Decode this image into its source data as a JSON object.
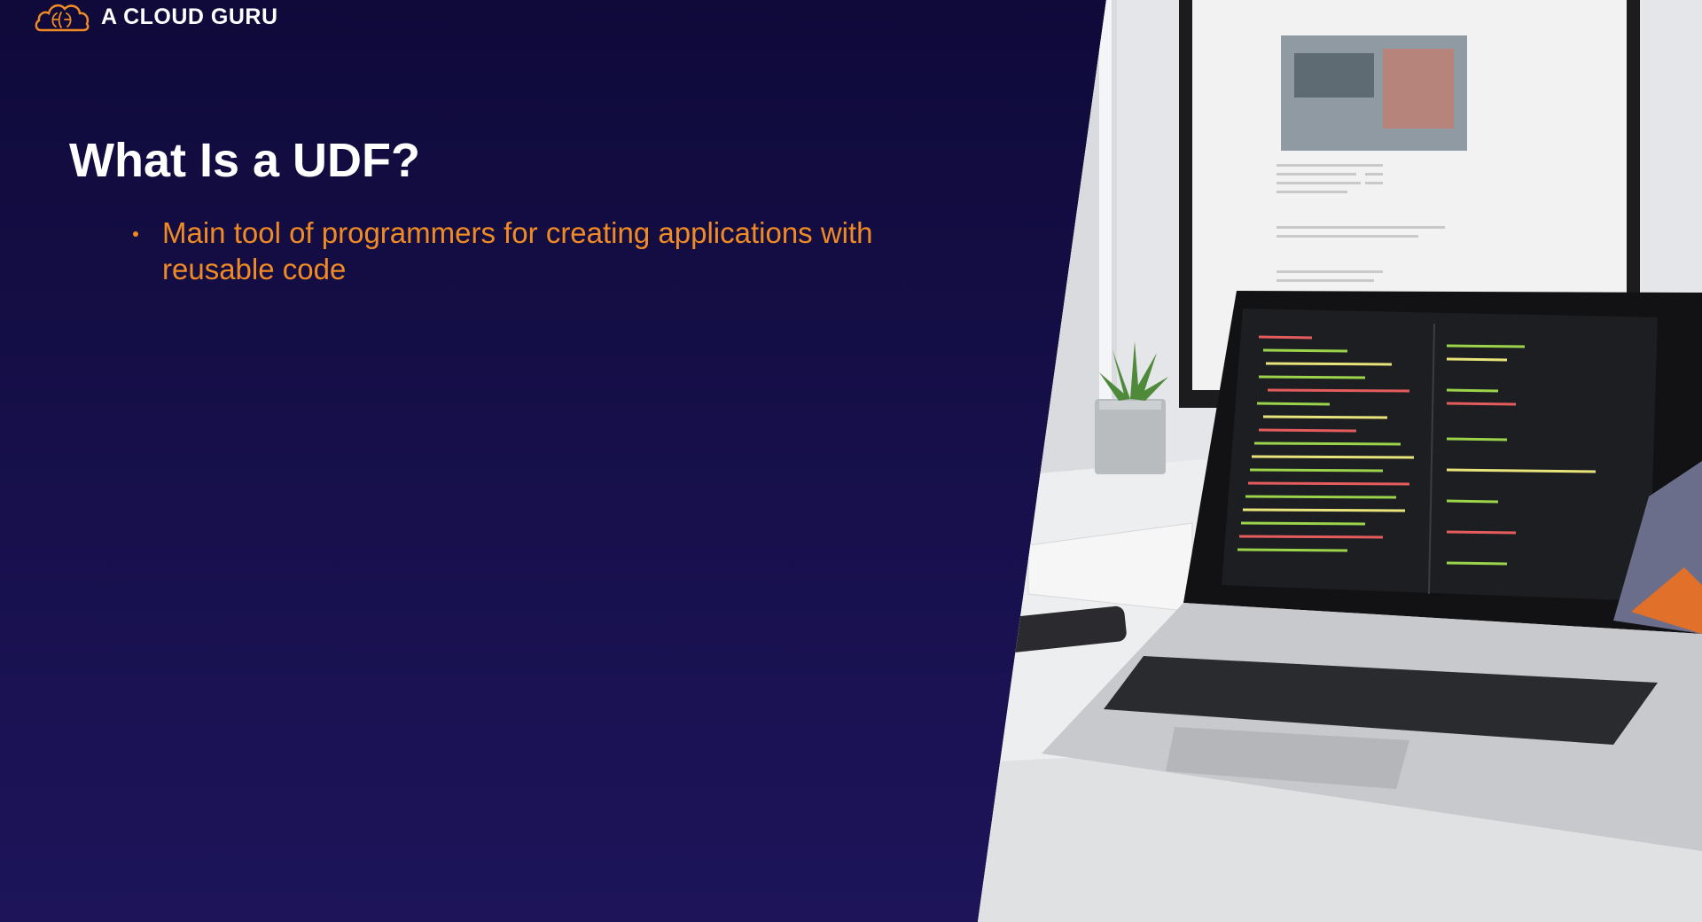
{
  "brand": {
    "name": "A CLOUD GURU",
    "logo_icon": "cloud-brain-icon",
    "accent_color": "#f08a24"
  },
  "slide": {
    "title": "What Is a UDF?",
    "bullets": [
      {
        "text": "Main tool of programmers for creating applications with reusable code"
      }
    ],
    "background_color": "#17104c",
    "bullet_color": "#f08a24"
  },
  "photo": {
    "subject_icon": "laptop-code-photo"
  }
}
